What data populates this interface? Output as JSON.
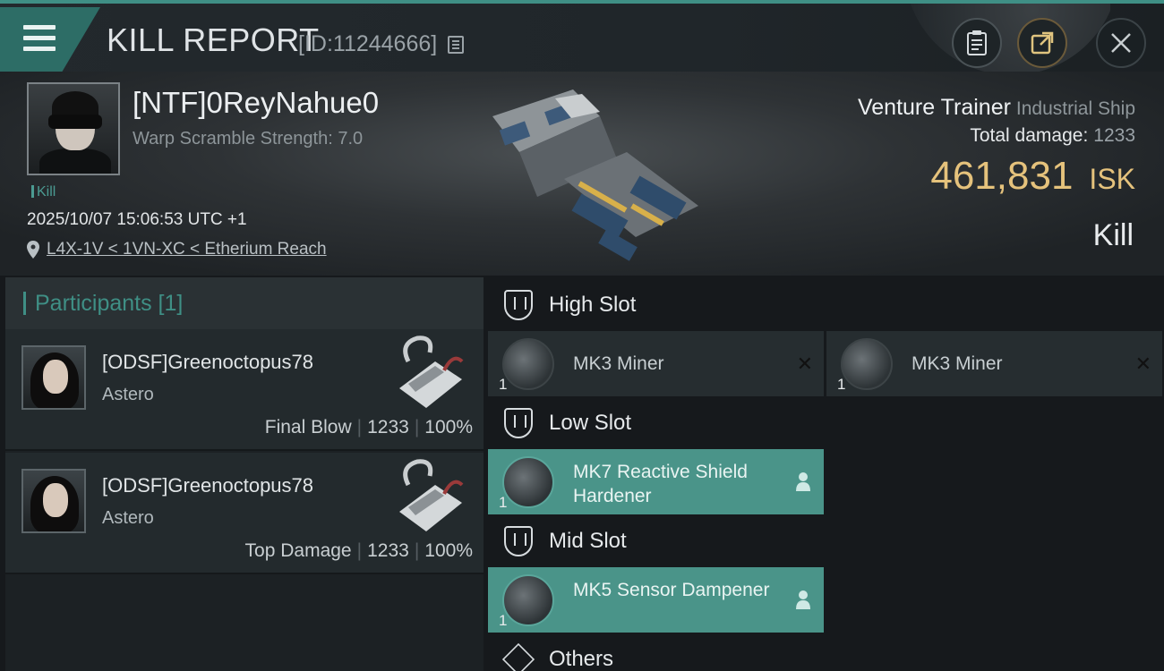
{
  "header": {
    "title": "KILL REPORT",
    "report_id": "[ID:11244666]"
  },
  "victim": {
    "name": "[NTF]0ReyNahue0",
    "warp_scramble": "Warp Scramble Strength: 7.0",
    "tag": "Kill",
    "timestamp": "2025/10/07 15:06:53 UTC +1",
    "location": "L4X-1V < 1VN-XC < Etherium Reach",
    "ship_name": "Venture Trainer",
    "ship_class": "Industrial Ship",
    "total_damage_label": "Total damage:",
    "total_damage": "1233",
    "isk_value": "461,831",
    "isk_unit": "ISK",
    "result": "Kill"
  },
  "participants": {
    "header": "Participants [1]",
    "rows": [
      {
        "name": "[ODSF]Greenoctopus78",
        "ship": "Astero",
        "role": "Final Blow",
        "damage": "1233",
        "percent": "100%"
      },
      {
        "name": "[ODSF]Greenoctopus78",
        "ship": "Astero",
        "role": "Top Damage",
        "damage": "1233",
        "percent": "100%"
      }
    ]
  },
  "slots": {
    "high": {
      "label": "High Slot",
      "items": [
        {
          "name": "MK3 Miner",
          "qty": "1"
        },
        {
          "name": "MK3 Miner",
          "qty": "1"
        }
      ]
    },
    "low": {
      "label": "Low Slot",
      "items": [
        {
          "name": "MK7 Reactive Shield Hardener",
          "qty": "1"
        }
      ]
    },
    "mid": {
      "label": "Mid Slot",
      "items": [
        {
          "name": "MK5 Sensor Dampener",
          "qty": "1"
        }
      ]
    },
    "others": {
      "label": "Others"
    }
  },
  "colors": {
    "accent": "#3f8f85",
    "isk": "#e5c27c",
    "highlight": "#4a9489"
  }
}
